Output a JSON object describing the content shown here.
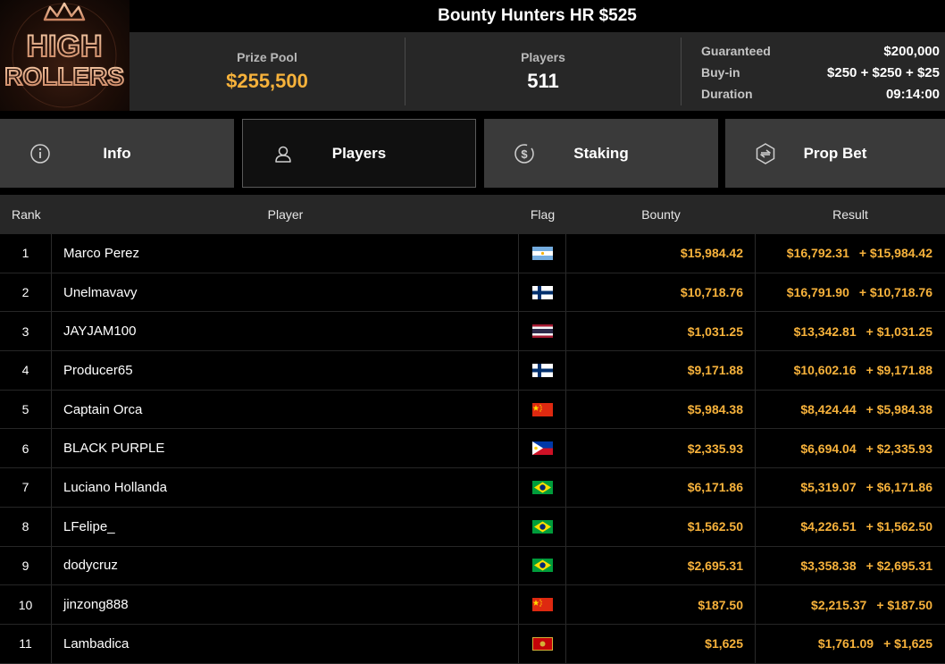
{
  "logo": {
    "line1": "HIGH",
    "line2": "ROLLERS"
  },
  "header": {
    "title": "Bounty Hunters HR $525"
  },
  "stats": {
    "prize_pool_label": "Prize Pool",
    "prize_pool_value": "$255,500",
    "players_label": "Players",
    "players_value": "511"
  },
  "details": {
    "guaranteed_label": "Guaranteed",
    "guaranteed_value": "$200,000",
    "buyin_label": "Buy-in",
    "buyin_value": "$250 + $250 + $25",
    "duration_label": "Duration",
    "duration_value": "09:14:00"
  },
  "tabs": [
    {
      "label": "Info",
      "icon": "info-icon"
    },
    {
      "label": "Players",
      "icon": "user-icon",
      "active": true
    },
    {
      "label": "Staking",
      "icon": "dollar-coin-icon"
    },
    {
      "label": "Prop Bet",
      "icon": "prop-bet-icon"
    }
  ],
  "table": {
    "headers": {
      "rank": "Rank",
      "player": "Player",
      "flag": "Flag",
      "bounty": "Bounty",
      "result": "Result"
    },
    "rows": [
      {
        "rank": "1",
        "player": "Marco Perez",
        "flag": "argentina",
        "bounty": "$15,984.42",
        "result": "$16,792.31",
        "result_bounty": "+ $15,984.42"
      },
      {
        "rank": "2",
        "player": "Unelmavavy",
        "flag": "finland",
        "bounty": "$10,718.76",
        "result": "$16,791.90",
        "result_bounty": "+ $10,718.76"
      },
      {
        "rank": "3",
        "player": "JAYJAM100",
        "flag": "thailand",
        "bounty": "$1,031.25",
        "result": "$13,342.81",
        "result_bounty": "+ $1,031.25"
      },
      {
        "rank": "4",
        "player": "Producer65",
        "flag": "finland",
        "bounty": "$9,171.88",
        "result": "$10,602.16",
        "result_bounty": "+ $9,171.88"
      },
      {
        "rank": "5",
        "player": "Captain Orca",
        "flag": "china",
        "bounty": "$5,984.38",
        "result": "$8,424.44",
        "result_bounty": "+ $5,984.38"
      },
      {
        "rank": "6",
        "player": "BLACK PURPLE",
        "flag": "philippines",
        "bounty": "$2,335.93",
        "result": "$6,694.04",
        "result_bounty": "+ $2,335.93"
      },
      {
        "rank": "7",
        "player": "Luciano Hollanda",
        "flag": "brazil",
        "bounty": "$6,171.86",
        "result": "$5,319.07",
        "result_bounty": "+ $6,171.86"
      },
      {
        "rank": "8",
        "player": "LFelipe_",
        "flag": "brazil",
        "bounty": "$1,562.50",
        "result": "$4,226.51",
        "result_bounty": "+ $1,562.50"
      },
      {
        "rank": "9",
        "player": "dodycruz",
        "flag": "brazil",
        "bounty": "$2,695.31",
        "result": "$3,358.38",
        "result_bounty": "+ $2,695.31"
      },
      {
        "rank": "10",
        "player": "jinzong888",
        "flag": "china",
        "bounty": "$187.50",
        "result": "$2,215.37",
        "result_bounty": "+ $187.50"
      },
      {
        "rank": "11",
        "player": "Lambadica",
        "flag": "montenegro",
        "bounty": "$1,625",
        "result": "$1,761.09",
        "result_bounty": "+ $1,625"
      }
    ]
  },
  "colors": {
    "gold": "#f7b23b",
    "panel": "#272727",
    "tab": "#3a3a3a"
  }
}
